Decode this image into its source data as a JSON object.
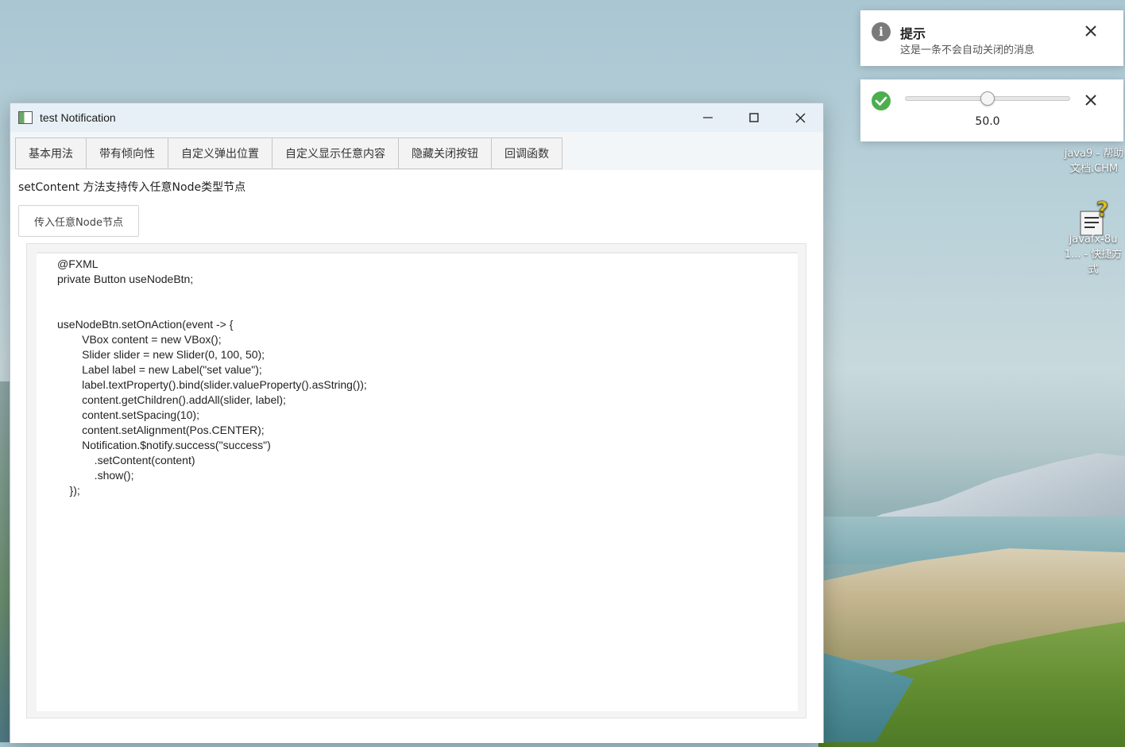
{
  "window": {
    "title": "test Notification",
    "controls": {
      "minimize": "—",
      "maximize": "☐",
      "close": "✕"
    }
  },
  "tabs": [
    {
      "label": "基本用法"
    },
    {
      "label": "带有倾向性"
    },
    {
      "label": "自定义弹出位置"
    },
    {
      "label": "自定义显示任意内容"
    },
    {
      "label": "隐藏关闭按钮"
    },
    {
      "label": "回调函数"
    }
  ],
  "content": {
    "description": "setContent 方法支持传入任意Node类型节点",
    "button_label": "传入任意Node节点",
    "code": "@FXML\nprivate Button useNodeBtn;\n\n\nuseNodeBtn.setOnAction(event -> {\n        VBox content = new VBox();\n        Slider slider = new Slider(0, 100, 50);\n        Label label = new Label(\"set value\");\n        label.textProperty().bind(slider.valueProperty().asString());\n        content.getChildren().addAll(slider, label);\n        content.setSpacing(10);\n        content.setAlignment(Pos.CENTER);\n        Notification.$notify.success(\"success\")\n            .setContent(content)\n            .show();\n    });"
  },
  "notifications": {
    "info": {
      "icon": "info-icon",
      "title": "提示",
      "message": "这是一条不会自动关闭的消息",
      "close": "✕"
    },
    "success": {
      "icon": "check-icon",
      "slider_value": 50.0,
      "slider_min": 0,
      "slider_max": 100,
      "value_label": "50.0",
      "close": "✕"
    }
  },
  "desktop": {
    "icons": [
      {
        "label": "java9 - 帮助文档.CHM"
      },
      {
        "label": "javafx-8u1... - 快捷方式"
      }
    ]
  },
  "colors": {
    "success": "#4cae4f",
    "info": "#7a7a7a"
  }
}
